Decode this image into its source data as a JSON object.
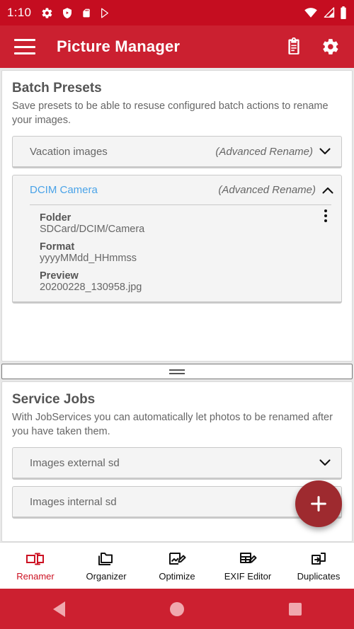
{
  "statusbar": {
    "time": "1:10",
    "icons_left": [
      "gear-icon",
      "play-protect-icon",
      "sdcard-icon",
      "play-store-icon"
    ],
    "icons_right": [
      "wifi-icon",
      "signal-icon",
      "battery-icon"
    ]
  },
  "appbar": {
    "menu_icon": "hamburger-menu-icon",
    "title": "Picture Manager",
    "actions": [
      {
        "name": "clipboard-icon",
        "label": "Clipboard"
      },
      {
        "name": "settings-gear-icon",
        "label": "Settings"
      }
    ]
  },
  "batch_presets": {
    "title": "Batch Presets",
    "description": "Save presets to be able to resuse configured batch actions to rename your images.",
    "items": [
      {
        "name": "Vacation images",
        "type": "(Advanced Rename)",
        "expanded": false,
        "chevron": "chevron-down-icon"
      },
      {
        "name": "DCIM Camera",
        "type": "(Advanced Rename)",
        "expanded": true,
        "chevron": "chevron-up-icon",
        "details": [
          {
            "key": "Folder",
            "value": "SDCard/DCIM/Camera"
          },
          {
            "key": "Format",
            "value": "yyyyMMdd_HHmmss"
          },
          {
            "key": "Preview",
            "value": "20200228_130958.jpg"
          }
        ]
      }
    ]
  },
  "splitter": {
    "name": "panel-drag-handle"
  },
  "service_jobs": {
    "title": "Service Jobs",
    "description": "With JobServices you can automatically let photos to be renamed after you have taken them.",
    "items": [
      {
        "name": "Images external sd",
        "chevron": "chevron-down-icon",
        "has_chevron": true
      },
      {
        "name": "Images internal sd",
        "chevron": "",
        "has_chevron": false
      }
    ]
  },
  "fab": {
    "label": "+",
    "name": "add-button"
  },
  "bottom_nav": {
    "items": [
      {
        "label": "Renamer",
        "icon": "rename-icon",
        "active": true
      },
      {
        "label": "Organizer",
        "icon": "folder-icon",
        "active": false
      },
      {
        "label": "Optimize",
        "icon": "image-edit-icon",
        "active": false
      },
      {
        "label": "EXIF Editor",
        "icon": "table-edit-icon",
        "active": false
      },
      {
        "label": "Duplicates",
        "icon": "copy-icon",
        "active": false
      }
    ]
  },
  "system_nav": {
    "back": "back-triangle-icon",
    "home": "home-circle-icon",
    "recents": "recents-square-icon"
  },
  "colors": {
    "status_bar": "#c50d20",
    "app_bar": "#cb2030",
    "accent": "#cc1122",
    "fab": "#9e2a2f",
    "link": "#4aa3e8",
    "system_nav": "#cc2030"
  }
}
